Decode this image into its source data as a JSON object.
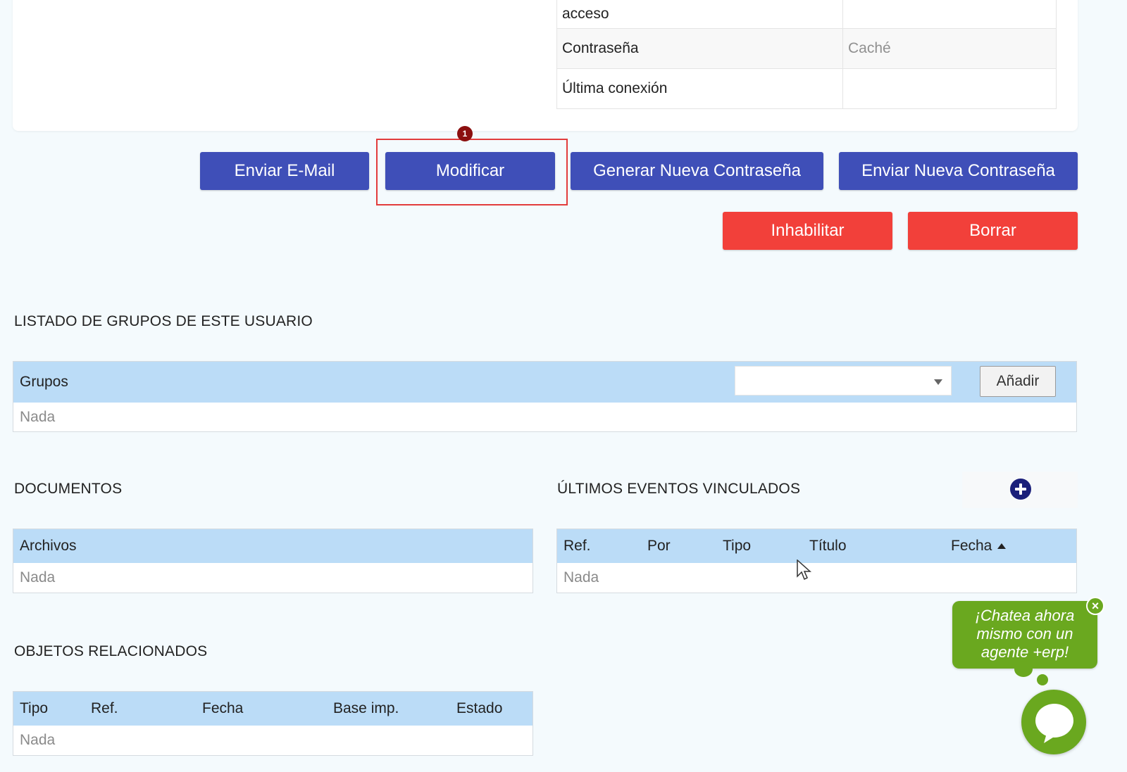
{
  "info_table": {
    "rows": [
      {
        "label": "acceso",
        "value": ""
      },
      {
        "label": "Contraseña",
        "value": "Caché"
      },
      {
        "label": "Última conexión",
        "value": ""
      }
    ]
  },
  "actions": {
    "send_email": "Enviar E-Mail",
    "modify": "Modificar",
    "modify_badge": "1",
    "generate_password": "Generar Nueva Contraseña",
    "send_password": "Enviar Nueva Contraseña",
    "disable": "Inhabilitar",
    "delete": "Borrar"
  },
  "groups_section": {
    "title": "LISTADO DE GRUPOS DE ESTE USUARIO",
    "header": "Grupos",
    "select_value": "",
    "add_label": "Añadir",
    "empty": "Nada"
  },
  "documents_section": {
    "title": "DOCUMENTOS",
    "header": "Archivos",
    "empty": "Nada"
  },
  "events_section": {
    "title": "ÚLTIMOS EVENTOS VINCULADOS",
    "columns": [
      "Ref.",
      "Por",
      "Tipo",
      "Título",
      "Fecha"
    ],
    "empty": "Nada"
  },
  "related_section": {
    "title": "OBJETOS RELACIONADOS",
    "columns": [
      "Tipo",
      "Ref.",
      "Fecha",
      "Base imp.",
      "Estado"
    ],
    "empty": "Nada"
  },
  "chat": {
    "line1": "¡Chatea ahora",
    "line2": "mismo con un",
    "line3": "agente +erp!",
    "close": "×"
  },
  "colors": {
    "primary_button": "#3f4fb8",
    "danger_button": "#f2403a",
    "table_header": "#bbdcf7",
    "chat_green": "#6aa81f"
  }
}
